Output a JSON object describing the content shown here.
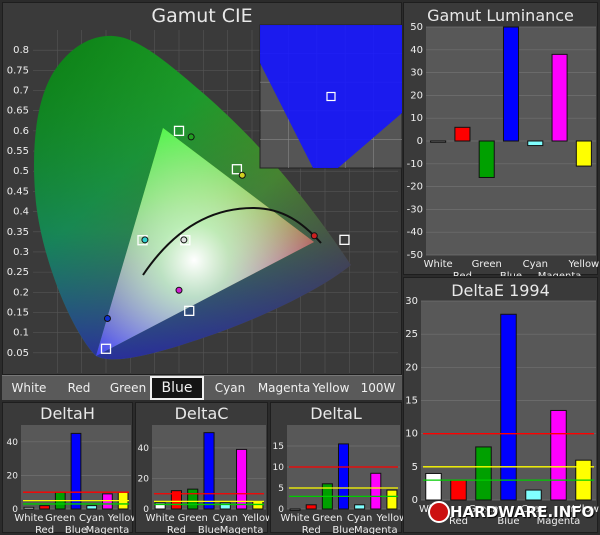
{
  "gamut_cie": {
    "title": "Gamut CIE",
    "y_ticks": [
      "0.8",
      "0.75",
      "0.7",
      "0.65",
      "0.6",
      "0.55",
      "0.5",
      "0.45",
      "0.4",
      "0.35",
      "0.3",
      "0.25",
      "0.2",
      "0.15",
      "0.1",
      "0.05"
    ]
  },
  "tabs": [
    "White",
    "Red",
    "Green",
    "Blue",
    "Cyan",
    "Magenta",
    "Yellow",
    "100W"
  ],
  "active_tab": "Blue",
  "logo_text": "HARDWARE.INFO",
  "chart_data": [
    {
      "type": "scatter",
      "title": "Gamut CIE",
      "xlim": [
        0,
        0.75
      ],
      "ylim": [
        0,
        0.85
      ],
      "grid": true,
      "series": [
        {
          "values": [
            {
              "x": 0.64,
              "y": 0.33
            },
            {
              "x": 0.3,
              "y": 0.6
            },
            {
              "x": 0.15,
              "y": 0.06
            },
            {
              "x": 0.313,
              "y": 0.329
            },
            {
              "x": 0.225,
              "y": 0.329
            },
            {
              "x": 0.321,
              "y": 0.154
            },
            {
              "x": 0.419,
              "y": 0.505
            }
          ]
        },
        {
          "values": [
            {
              "x": 0.578,
              "y": 0.34
            },
            {
              "x": 0.325,
              "y": 0.585
            },
            {
              "x": 0.153,
              "y": 0.135
            },
            {
              "x": 0.31,
              "y": 0.33
            },
            {
              "x": 0.23,
              "y": 0.33
            },
            {
              "x": 0.3,
              "y": 0.205
            },
            {
              "x": 0.43,
              "y": 0.49
            }
          ]
        }
      ],
      "inset": {
        "marker": {
          "x": 0.5,
          "y": 0.5
        }
      }
    },
    {
      "type": "bar",
      "title": "Gamut Luminance",
      "categories": [
        "White",
        "Red",
        "Green",
        "Blue",
        "Cyan",
        "Magenta",
        "Yellow"
      ],
      "values": [
        0,
        6,
        -16,
        50,
        -2,
        38,
        -11
      ],
      "colors": [
        "#ffffff",
        "#ff0000",
        "#00a000",
        "#0000ff",
        "#80ffff",
        "#ff00ff",
        "#ffff00"
      ],
      "ylim": [
        -50,
        50
      ],
      "yticks": [
        50,
        40,
        30,
        20,
        10,
        0,
        -10,
        -20,
        -30,
        -40,
        -50
      ]
    },
    {
      "type": "bar",
      "title": "DeltaE 1994",
      "categories": [
        "White",
        "Red",
        "Green",
        "Blue",
        "Cyan",
        "Magenta",
        "Yellow"
      ],
      "values": [
        4,
        3,
        8,
        28,
        1.5,
        13.5,
        6
      ],
      "colors": [
        "#ffffff",
        "#ff0000",
        "#00a000",
        "#0000ff",
        "#80ffff",
        "#ff00ff",
        "#ffff00"
      ],
      "ylim": [
        0,
        30
      ],
      "yticks": [
        30,
        25,
        20,
        15,
        10,
        5,
        0
      ],
      "reference_lines": [
        {
          "value": 10,
          "color": "#ff0000"
        },
        {
          "value": 5,
          "color": "#ffff00"
        },
        {
          "value": 3,
          "color": "#00cc00"
        }
      ]
    },
    {
      "type": "bar",
      "title": "DeltaH",
      "categories": [
        "White",
        "Red",
        "Green",
        "Blue",
        "Cyan",
        "Magenta",
        "Yellow"
      ],
      "values": [
        1,
        2,
        10,
        45,
        2,
        9,
        10
      ],
      "colors": [
        "#ffffff",
        "#ff0000",
        "#00a000",
        "#0000ff",
        "#80ffff",
        "#ff00ff",
        "#ffff00"
      ],
      "ylim": [
        0,
        50
      ],
      "yticks": [
        40,
        20,
        0
      ],
      "reference_lines": [
        {
          "value": 10,
          "color": "#ff0000"
        },
        {
          "value": 5,
          "color": "#ffff00"
        },
        {
          "value": 3,
          "color": "#00cc00"
        }
      ]
    },
    {
      "type": "bar",
      "title": "DeltaC",
      "categories": [
        "White",
        "Red",
        "Green",
        "Blue",
        "Cyan",
        "Magenta",
        "Yellow"
      ],
      "values": [
        4,
        12,
        13,
        50,
        4,
        39,
        5
      ],
      "colors": [
        "#ffffff",
        "#ff0000",
        "#00a000",
        "#0000ff",
        "#80ffff",
        "#ff00ff",
        "#ffff00"
      ],
      "ylim": [
        0,
        55
      ],
      "yticks": [
        40,
        20,
        0
      ],
      "reference_lines": [
        {
          "value": 10,
          "color": "#ff0000"
        },
        {
          "value": 5,
          "color": "#ffff00"
        },
        {
          "value": 3,
          "color": "#00cc00"
        }
      ]
    },
    {
      "type": "bar",
      "title": "DeltaL",
      "categories": [
        "White",
        "Red",
        "Green",
        "Blue",
        "Cyan",
        "Magenta",
        "Yellow"
      ],
      "values": [
        0,
        1,
        6,
        15.5,
        1,
        8.5,
        4.5
      ],
      "colors": [
        "#ffffff",
        "#ff0000",
        "#00a000",
        "#0000ff",
        "#80ffff",
        "#ff00ff",
        "#ffff00"
      ],
      "ylim": [
        0,
        20
      ],
      "yticks": [
        15,
        10,
        5,
        0
      ],
      "reference_lines": [
        {
          "value": 10,
          "color": "#ff0000"
        },
        {
          "value": 5,
          "color": "#ffff00"
        },
        {
          "value": 3,
          "color": "#00cc00"
        }
      ]
    }
  ]
}
